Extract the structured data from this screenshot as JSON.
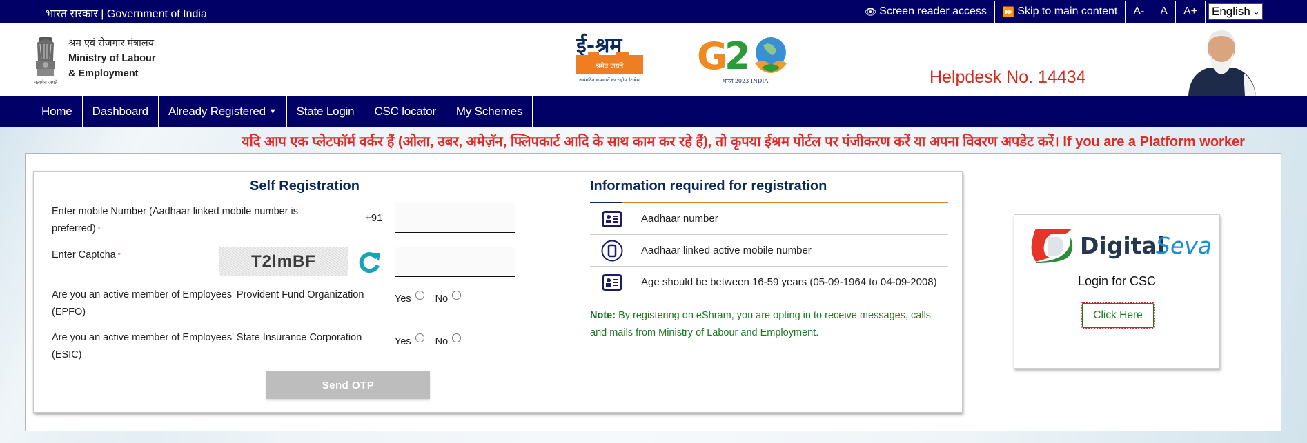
{
  "topbar": {
    "gov_label": "भारत सरकार | Government of India",
    "screen_reader": "Screen reader access",
    "skip_content": "Skip to main content",
    "font_decrease": "A-",
    "font_normal": "A",
    "font_increase": "A+",
    "language": "English"
  },
  "header": {
    "ministry_hi": "श्रम एवं रोजगार मंत्रालय",
    "ministry_en_1": "Ministry of Labour",
    "ministry_en_2": "& Employment",
    "emblem_motto": "सत्यमेव जयते",
    "eshram_title": "ई-श्रम",
    "eshram_tagline": "श्रमेव जयते",
    "eshram_sub": "असंगठित कामगारों का राष्ट्रीय डेटाबेस",
    "g20_text": "G20",
    "g20_sub": "भारत 2023 INDIA",
    "helpdesk": "Helpdesk No. 14434"
  },
  "nav": {
    "items": [
      {
        "label": "Home"
      },
      {
        "label": "Dashboard"
      },
      {
        "label": "Already Registered",
        "dropdown": true
      },
      {
        "label": "State Login"
      },
      {
        "label": "CSC locator"
      },
      {
        "label": "My Schemes"
      }
    ]
  },
  "marquee": "यदि आप एक प्लेटफॉर्म वर्कर हैं (ओला, उबर, अमेज़ॅन, फ्लिपकार्ट आदि के साथ काम कर रहे हैं), तो कृपया ईश्रम पोर्टल पर पंजीकरण करें या अपना विवरण अपडेट करें। If you are a Platform worker",
  "self_registration": {
    "title": "Self Registration",
    "mobile_label_1": "Enter mobile Number (Aadhaar linked mobile number is",
    "mobile_label_2": "preferred)",
    "required_mark": "*",
    "country_code": "+91",
    "mobile_value": "",
    "captcha_label": "Enter Captcha",
    "captcha_text": "T2lmBF",
    "captcha_value": "",
    "epfo_label_1": "Are you an active member of Employees' Provident Fund Organization",
    "epfo_label_2": "(EPFO)",
    "esic_label_1": "Are you an active member of Employees' State Insurance Corporation",
    "esic_label_2": "(ESIC)",
    "yes": "Yes",
    "no": "No",
    "send_otp": "Send OTP"
  },
  "info": {
    "title": "Information required for registration",
    "items": [
      {
        "icon": "id-card-icon",
        "text": "Aadhaar number"
      },
      {
        "icon": "mobile-icon",
        "text": "Aadhaar linked active mobile number"
      },
      {
        "icon": "id-card-icon",
        "text": "Age should be between 16-59 years (05-09-1964 to 04-09-2008)"
      }
    ],
    "note_label": "Note:",
    "note_text": " By registering on eShram, you are opting in to receive messages, calls and mails from Ministry of Labour and Employment."
  },
  "csc": {
    "brand_1": "Digital",
    "brand_2": "Seva",
    "title": "Login for CSC",
    "button": "Click Here"
  },
  "colors": {
    "navy": "#000066",
    "helpdesk_red": "#d42a1d",
    "marquee_red": "#e02a27",
    "title_blue": "#0b2a5b",
    "note_green": "#1a7a22",
    "accent_orange": "#e07b25"
  }
}
